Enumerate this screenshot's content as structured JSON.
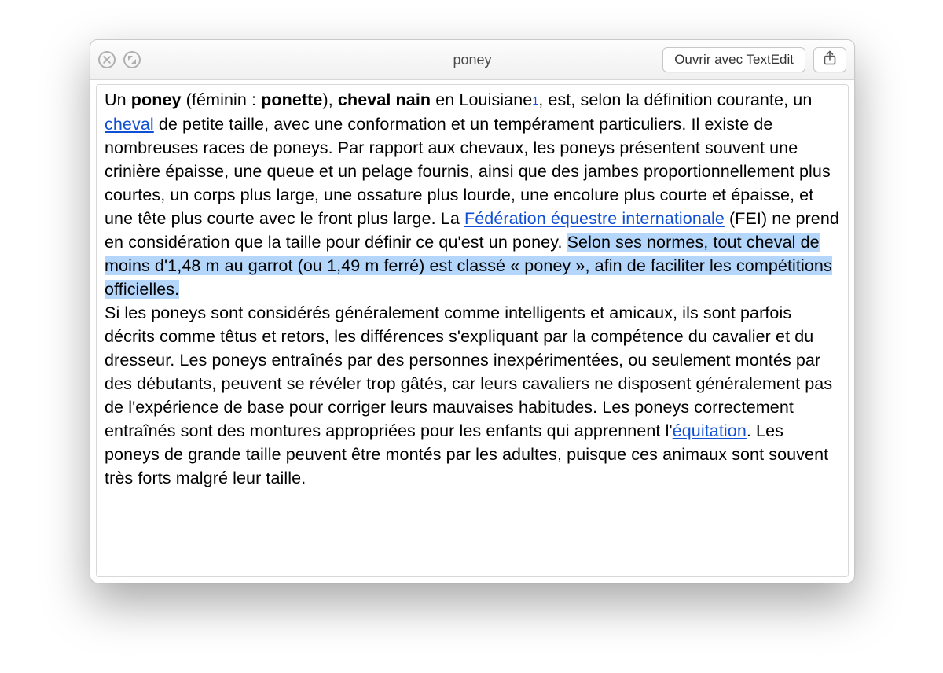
{
  "titlebar": {
    "title": "poney",
    "open_with_label": "Ouvrir avec TextEdit"
  },
  "content": {
    "p1": {
      "t1": "Un ",
      "b1": "poney",
      "t2": " (féminin : ",
      "b2": "ponette",
      "t3": "), ",
      "b3": "cheval nain",
      "t4": " en Louisiane",
      "ref1": "1",
      "t5": ", est, selon la définition courante, un ",
      "link1": "cheval",
      "t6": " de petite taille, avec une conformation et un tempérament particuliers. Il existe de nombreuses races de poneys. Par rapport aux chevaux, les poneys présentent souvent une crinière épaisse, une queue et un pelage fournis, ainsi que des jambes proportionnellement plus courtes, un corps plus large, une ossature plus lourde, une encolure plus courte et épaisse, et une tête plus courte avec le front plus large. La ",
      "link2": "Fédération équestre internationale",
      "t7": " (FEI) ne prend en considération que la taille pour définir ce qu'est un poney. ",
      "sel": "Selon ses normes, tout cheval de moins d'1,48 m au garrot (ou 1,49 m ferré) est classé « poney », afin de faciliter les compétitions officielles."
    },
    "p2": {
      "t1": "Si les poneys sont considérés généralement comme intelligents et amicaux, ils sont parfois décrits comme têtus et retors, les différences s'expliquant par la compétence du cavalier et du dresseur. Les poneys entraînés par des personnes inexpérimentées, ou seulement montés par des débutants, peuvent se révéler trop gâtés, car leurs cavaliers ne disposent généralement pas de l'expérience de base pour corriger leurs mauvaises habitudes. Les poneys correctement entraînés sont des montures appropriées pour les enfants qui apprennent l'",
      "link1": "équitation",
      "t2": ". Les poneys de grande taille peuvent être montés par les adultes, puisque ces animaux sont souvent très forts malgré leur taille."
    }
  }
}
